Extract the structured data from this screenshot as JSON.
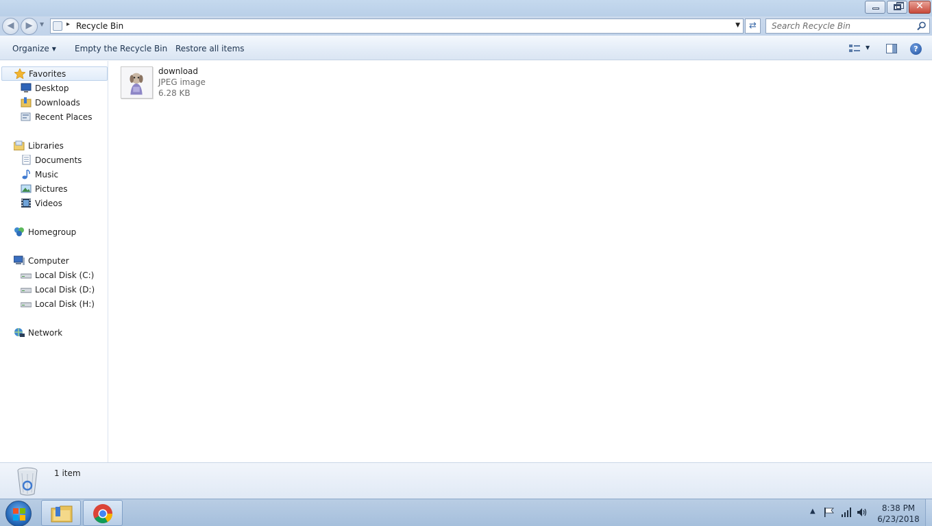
{
  "window": {
    "controls": {
      "minimize": "minimize",
      "maximize": "restore",
      "close": "✕"
    }
  },
  "navbar": {
    "back_icon": "back-arrow-icon",
    "forward_icon": "forward-arrow-icon",
    "address": {
      "separator": "▸",
      "location": "Recycle Bin",
      "dropdown": "▼"
    },
    "refresh_icon": "refresh-icon",
    "search": {
      "placeholder": "Search Recycle Bin"
    }
  },
  "commandbar": {
    "organize": "Organize",
    "empty": "Empty the Recycle Bin",
    "restore": "Restore all items",
    "help": "?"
  },
  "navpane": {
    "favorites": "Favorites",
    "favorites_items": [
      "Desktop",
      "Downloads",
      "Recent Places"
    ],
    "libraries": "Libraries",
    "libraries_items": [
      "Documents",
      "Music",
      "Pictures",
      "Videos"
    ],
    "homegroup": "Homegroup",
    "computer": "Computer",
    "computer_items": [
      "Local Disk (C:)",
      "Local Disk (D:)",
      "Local Disk (H:)"
    ],
    "network": "Network"
  },
  "content": {
    "items": [
      {
        "name": "download",
        "type": "JPEG image",
        "size": "6.28 KB"
      }
    ]
  },
  "details": {
    "count": "1 item"
  },
  "taskbar": {
    "time": "8:38 PM",
    "date": "6/23/2018"
  },
  "colors": {
    "accent": "#3b6aa8",
    "selection": "#e1ecf9",
    "title_bar": "#c5d9ee",
    "close_button": "#c8493a"
  }
}
